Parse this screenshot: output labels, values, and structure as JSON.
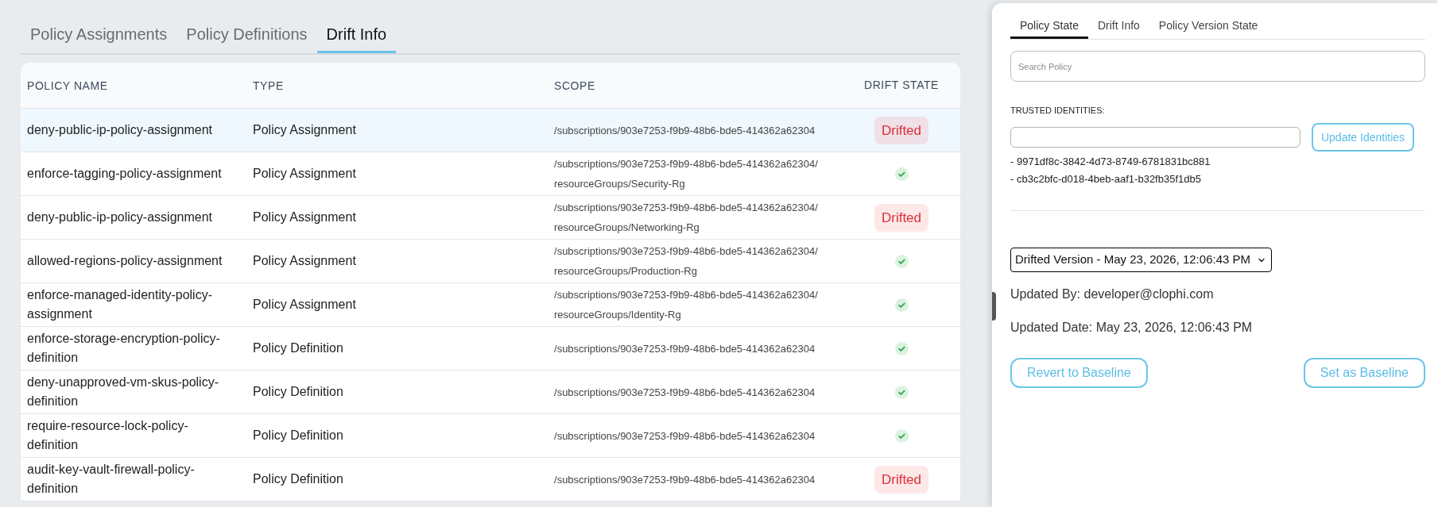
{
  "tabs": [
    {
      "label": "Policy Assignments",
      "selected": false
    },
    {
      "label": "Policy Definitions",
      "selected": false
    },
    {
      "label": "Drift Info",
      "selected": true
    }
  ],
  "table": {
    "columns": [
      "POLICY NAME",
      "TYPE",
      "SCOPE",
      "DRIFT STATE"
    ],
    "rows": [
      {
        "policy_name": "deny-public-ip-policy-assignment",
        "type": "Policy Assignment",
        "scope": "/subscriptions/903e7253-f9b9-48b6-bde5-414362a62304",
        "drift_state": {
          "kind": "drifted",
          "label": "Drifted"
        },
        "selected": true
      },
      {
        "policy_name": "enforce-tagging-policy-assignment",
        "type": "Policy Assignment",
        "scope": "/subscriptions/903e7253-f9b9-48b6-bde5-414362a62304/resourceGroups/Security-Rg",
        "drift_state": {
          "kind": "in_sync"
        },
        "selected": false
      },
      {
        "policy_name": "deny-public-ip-policy-assignment",
        "type": "Policy Assignment",
        "scope": "/subscriptions/903e7253-f9b9-48b6-bde5-414362a62304/resourceGroups/Networking-Rg",
        "drift_state": {
          "kind": "drifted",
          "label": "Drifted"
        },
        "selected": false
      },
      {
        "policy_name": "allowed-regions-policy-assignment",
        "type": "Policy Assignment",
        "scope": "/subscriptions/903e7253-f9b9-48b6-bde5-414362a62304/resourceGroups/Production-Rg",
        "drift_state": {
          "kind": "in_sync"
        },
        "selected": false
      },
      {
        "policy_name": "enforce-managed-identity-policy-assignment",
        "type": "Policy Assignment",
        "scope": "/subscriptions/903e7253-f9b9-48b6-bde5-414362a62304/resourceGroups/Identity-Rg",
        "drift_state": {
          "kind": "in_sync"
        },
        "selected": false
      },
      {
        "policy_name": "enforce-storage-encryption-policy-definition",
        "type": "Policy Definition",
        "scope": "/subscriptions/903e7253-f9b9-48b6-bde5-414362a62304",
        "drift_state": {
          "kind": "in_sync"
        },
        "selected": false
      },
      {
        "policy_name": "deny-unapproved-vm-skus-policy-definition",
        "type": "Policy Definition",
        "scope": "/subscriptions/903e7253-f9b9-48b6-bde5-414362a62304",
        "drift_state": {
          "kind": "in_sync"
        },
        "selected": false
      },
      {
        "policy_name": "require-resource-lock-policy-definition",
        "type": "Policy Definition",
        "scope": "/subscriptions/903e7253-f9b9-48b6-bde5-414362a62304",
        "drift_state": {
          "kind": "in_sync"
        },
        "selected": false
      },
      {
        "policy_name": "audit-key-vault-firewall-policy-definition",
        "type": "Policy Definition",
        "scope": "/subscriptions/903e7253-f9b9-48b6-bde5-414362a62304",
        "drift_state": {
          "kind": "drifted",
          "label": "Drifted"
        },
        "selected": false
      }
    ]
  },
  "side_panel": {
    "tabs": [
      {
        "label": "Policy State",
        "selected": true
      },
      {
        "label": "Drift Info",
        "selected": false
      },
      {
        "label": "Policy Version State",
        "selected": false
      }
    ],
    "search": {
      "placeholder": "Search Policy"
    },
    "trusted_identities": {
      "label": "TRUSTED IDENTITIES:",
      "button": "Update Identities",
      "items": [
        "- 9971df8c-3842-4d73-8749-6781831bc881",
        "- cb3c2bfc-d018-4beb-aaf1-b32fb35f1db5"
      ]
    },
    "version_select": {
      "value": "Drifted Version - May 23, 2026, 12:06:43 PM"
    },
    "updated_by": "Updated By: developer@clophi.com",
    "updated_date": "Updated Date: May 23, 2026, 12:06:43 PM",
    "buttons": [
      "Revert to Baseline",
      "Set as Baseline"
    ]
  }
}
